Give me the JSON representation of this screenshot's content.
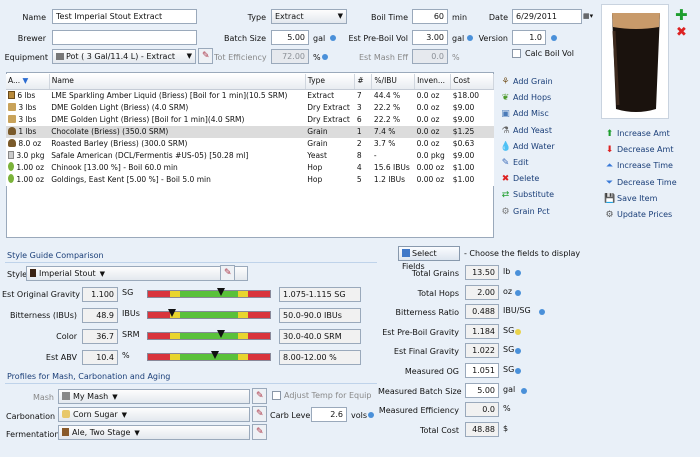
{
  "form": {
    "name_label": "Name",
    "name_value": "Test Imperial Stout Extract",
    "brewer_label": "Brewer",
    "brewer_value": "",
    "equipment_label": "Equipment",
    "equipment_value": "Pot ( 3 Gal/11.4 L) - Extract",
    "type_label": "Type",
    "type_value": "Extract",
    "batch_label": "Batch Size",
    "batch_value": "5.00",
    "batch_unit": "gal",
    "tot_eff_label": "Tot Efficiency",
    "tot_eff_value": "72.00",
    "tot_eff_unit": "%",
    "boil_time_label": "Boil Time",
    "boil_time_value": "60",
    "boil_time_unit": "min",
    "preboil_label": "Est Pre-Boil Vol",
    "preboil_value": "3.00",
    "preboil_unit": "gal",
    "mash_eff_label": "Est Mash Eff",
    "mash_eff_value": "0.0",
    "mash_eff_unit": "%",
    "date_label": "Date",
    "date_value": "6/29/2011",
    "version_label": "Version",
    "version_value": "1.0",
    "calc_boil_label": "Calc Boil Vol"
  },
  "table": {
    "headers": [
      "A...",
      "Name",
      "Type",
      "#",
      "%/IBU",
      "Inven...",
      "Cost"
    ],
    "rows": [
      {
        "amt": "6 lbs",
        "name": "LME Sparkling Amber Liquid (Briess) [Boil for 1 min](10.5 SRM)",
        "type": "Extract",
        "num": "7",
        "pct": "44.4 %",
        "inv": "0.0 oz",
        "cost": "$18.00",
        "icon": "extract"
      },
      {
        "amt": "3 lbs",
        "name": "DME Golden Light (Briess) (4.0 SRM)",
        "type": "Dry Extract",
        "num": "3",
        "pct": "22.2 %",
        "inv": "0.0 oz",
        "cost": "$9.00",
        "icon": "dme"
      },
      {
        "amt": "3 lbs",
        "name": "DME Golden Light (Briess) [Boil for 1 min](4.0 SRM)",
        "type": "Dry Extract",
        "num": "6",
        "pct": "22.2 %",
        "inv": "0.0 oz",
        "cost": "$9.00",
        "icon": "dme"
      },
      {
        "amt": "1 lbs",
        "name": "Chocolate (Briess) (350.0 SRM)",
        "type": "Grain",
        "num": "1",
        "pct": "7.4 %",
        "inv": "0.0 oz",
        "cost": "$1.25",
        "icon": "grain"
      },
      {
        "amt": "8.0 oz",
        "name": "Roasted Barley (Briess) (300.0 SRM)",
        "type": "Grain",
        "num": "2",
        "pct": "3.7 %",
        "inv": "0.0 oz",
        "cost": "$0.63",
        "icon": "grain"
      },
      {
        "amt": "3.0 pkg",
        "name": "Safale American  (DCL/Fermentis #US-05) [50.28 ml]",
        "type": "Yeast",
        "num": "8",
        "pct": "-",
        "inv": "0.0 pkg",
        "cost": "$9.00",
        "icon": "yeast"
      },
      {
        "amt": "1.00 oz",
        "name": "Chinook [13.00 %] - Boil 60.0 min",
        "type": "Hop",
        "num": "4",
        "pct": "15.6 IBUs",
        "inv": "0.00 oz",
        "cost": "$1.00",
        "icon": "hop"
      },
      {
        "amt": "1.00 oz",
        "name": "Goldings, East Kent [5.00 %] - Boil 5.0 min",
        "type": "Hop",
        "num": "5",
        "pct": "1.2 IBUs",
        "inv": "0.00 oz",
        "cost": "$1.00",
        "icon": "hop"
      }
    ]
  },
  "actions": [
    "Add Grain",
    "Add Hops",
    "Add Misc",
    "Add Yeast",
    "Add Water",
    "Edit",
    "Delete",
    "Substitute",
    "Grain Pct"
  ],
  "actions2": [
    "Increase Amt",
    "Decrease Amt",
    "Increase Time",
    "Decrease Time",
    "Save Item",
    "Update Prices"
  ],
  "style": {
    "section_title": "Style Guide Comparison",
    "style_label": "Style",
    "style_value": "Imperial Stout",
    "rows": [
      {
        "label": "Est Original Gravity",
        "value": "1.100",
        "unit": "SG",
        "range": "1.075-1.115 SG",
        "marker": 0.6
      },
      {
        "label": "Bitterness (IBUs)",
        "value": "48.9",
        "unit": "IBUs",
        "range": "50.0-90.0 IBUs",
        "marker": 0.2
      },
      {
        "label": "Color",
        "value": "36.7",
        "unit": "SRM",
        "range": "30.0-40.0 SRM",
        "marker": 0.6
      },
      {
        "label": "Est ABV",
        "value": "10.4",
        "unit": "%",
        "range": "8.00-12.00 %",
        "marker": 0.55
      }
    ]
  },
  "profiles": {
    "section_title": "Profiles for Mash, Carbonation and Aging",
    "mash_label": "Mash",
    "mash_value": "My Mash",
    "adjust_label": "Adjust Temp for Equip",
    "carb_label": "Carbonation",
    "carb_value": "Corn Sugar",
    "carb_level_label": "Carb Level",
    "carb_level_value": "2.6",
    "carb_level_unit": "vols",
    "ferm_label": "Fermentation",
    "ferm_value": "Ale, Two Stage"
  },
  "stats": {
    "select_fields": "Select Fields",
    "select_hint": "- Choose the fields to display",
    "rows": [
      {
        "label": "Total Grains",
        "value": "13.50",
        "unit": "lb",
        "dot": "b"
      },
      {
        "label": "Total Hops",
        "value": "2.00",
        "unit": "oz",
        "dot": "b"
      },
      {
        "label": "Bitterness Ratio",
        "value": "0.488",
        "unit": "IBU/SG",
        "dot": "b"
      },
      {
        "label": "Est Pre-Boil Gravity",
        "value": "1.184",
        "unit": "SG",
        "dot": "y"
      },
      {
        "label": "Est Final Gravity",
        "value": "1.022",
        "unit": "SG",
        "dot": "b"
      },
      {
        "label": "Measured OG",
        "value": "1.051",
        "unit": "SG",
        "dot": "b"
      },
      {
        "label": "Measured Batch Size",
        "value": "5.00",
        "unit": "gal",
        "dot": "b"
      },
      {
        "label": "Measured Efficiency",
        "value": "0.0",
        "unit": "%",
        "dot": ""
      },
      {
        "label": "Total Cost",
        "value": "48.88",
        "unit": "$",
        "dot": ""
      }
    ]
  }
}
